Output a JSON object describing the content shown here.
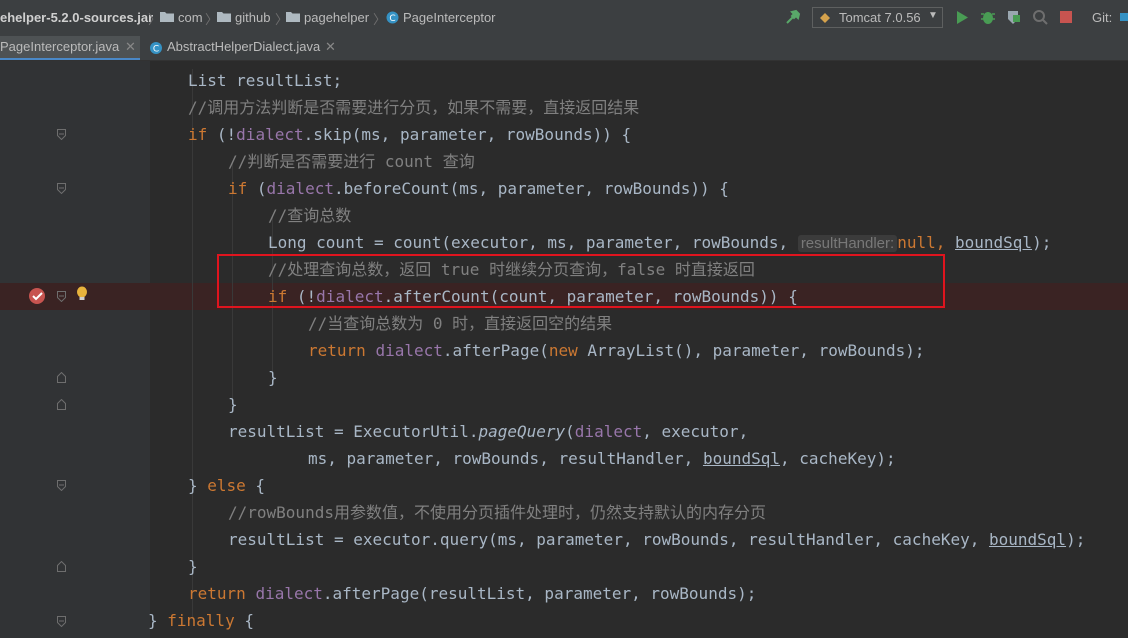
{
  "breadcrumb": {
    "jar": "ehelper-5.2.0-sources.jar",
    "pkg1": "com",
    "pkg2": "github",
    "pkg3": "pagehelper",
    "class": "PageInterceptor"
  },
  "toolbar": {
    "run_config": "Tomcat 7.0.56",
    "vcs_label": "Git:"
  },
  "tabs": [
    {
      "label": "PageInterceptor.java"
    },
    {
      "label": "AbstractHelperDialect.java"
    }
  ],
  "code": {
    "l1_b": "List resultList;",
    "l2": "//调用方法判断是否需要进行分页，如果不需要，直接返回结果",
    "l3_kw": "if",
    "l3_a": " (!",
    "l3_fld": "dialect",
    "l3_b": ".skip(ms, parameter, rowBounds)) {",
    "l4": "//判断是否需要进行 count 查询",
    "l5_kw": "if",
    "l5_a": " (",
    "l5_fld": "dialect",
    "l5_b": ".beforeCount(ms, parameter, rowBounds)) {",
    "l6": "//查询总数",
    "l7_a": "Long count = count(executor, ms, parameter, rowBounds, ",
    "l7_hint": "resultHandler:",
    "l7_null": "null",
    "l7_b": ", ",
    "l7_und": "boundSql",
    "l7_c": ");",
    "l8": "//处理查询总数，返回 true 时继续分页查询，false 时直接返回",
    "l9_kw": "if",
    "l9_a": " (!",
    "l9_fld": "dialect",
    "l9_b": ".afterCount(count, parameter, rowBounds)) {",
    "l10": "//当查询总数为 0 时，直接返回空的结果",
    "l11_kw": "return",
    "l11_fld": "dialect",
    "l11_a": ".afterPage(",
    "l11_new": "new",
    "l11_b": " ArrayList(), parameter, rowBounds);",
    "l12": "}",
    "l13": "}",
    "l14_a": "resultList = ExecutorUtil.",
    "l14_ital": "pageQuery",
    "l14_b": "(",
    "l14_fld": "dialect",
    "l14_c": ", executor,",
    "l15_a": "ms, parameter, rowBounds, resultHandler, ",
    "l15_und": "boundSql",
    "l15_b": ", cacheKey);",
    "l16_a": "} ",
    "l16_kw": "else",
    "l16_b": " {",
    "l17": "//rowBounds用参数值，不使用分页插件处理时，仍然支持默认的内存分页",
    "l18_a": "resultList = executor.query(ms, parameter, rowBounds, resultHandler, cacheKey, ",
    "l18_und": "boundSql",
    "l18_b": ");",
    "l19": "}",
    "l20_kw": "return",
    "l20_fld": "dialect",
    "l20_a": ".afterPage(resultList, parameter, rowBounds);",
    "l21_a": "} ",
    "l21_kw": "finally",
    "l21_b": " {"
  },
  "colors": {
    "keyword": "#cc7832",
    "field": "#9876aa",
    "comment": "#808080",
    "highlight_border": "#e0141e",
    "tab_underline": "#4a88c7"
  }
}
